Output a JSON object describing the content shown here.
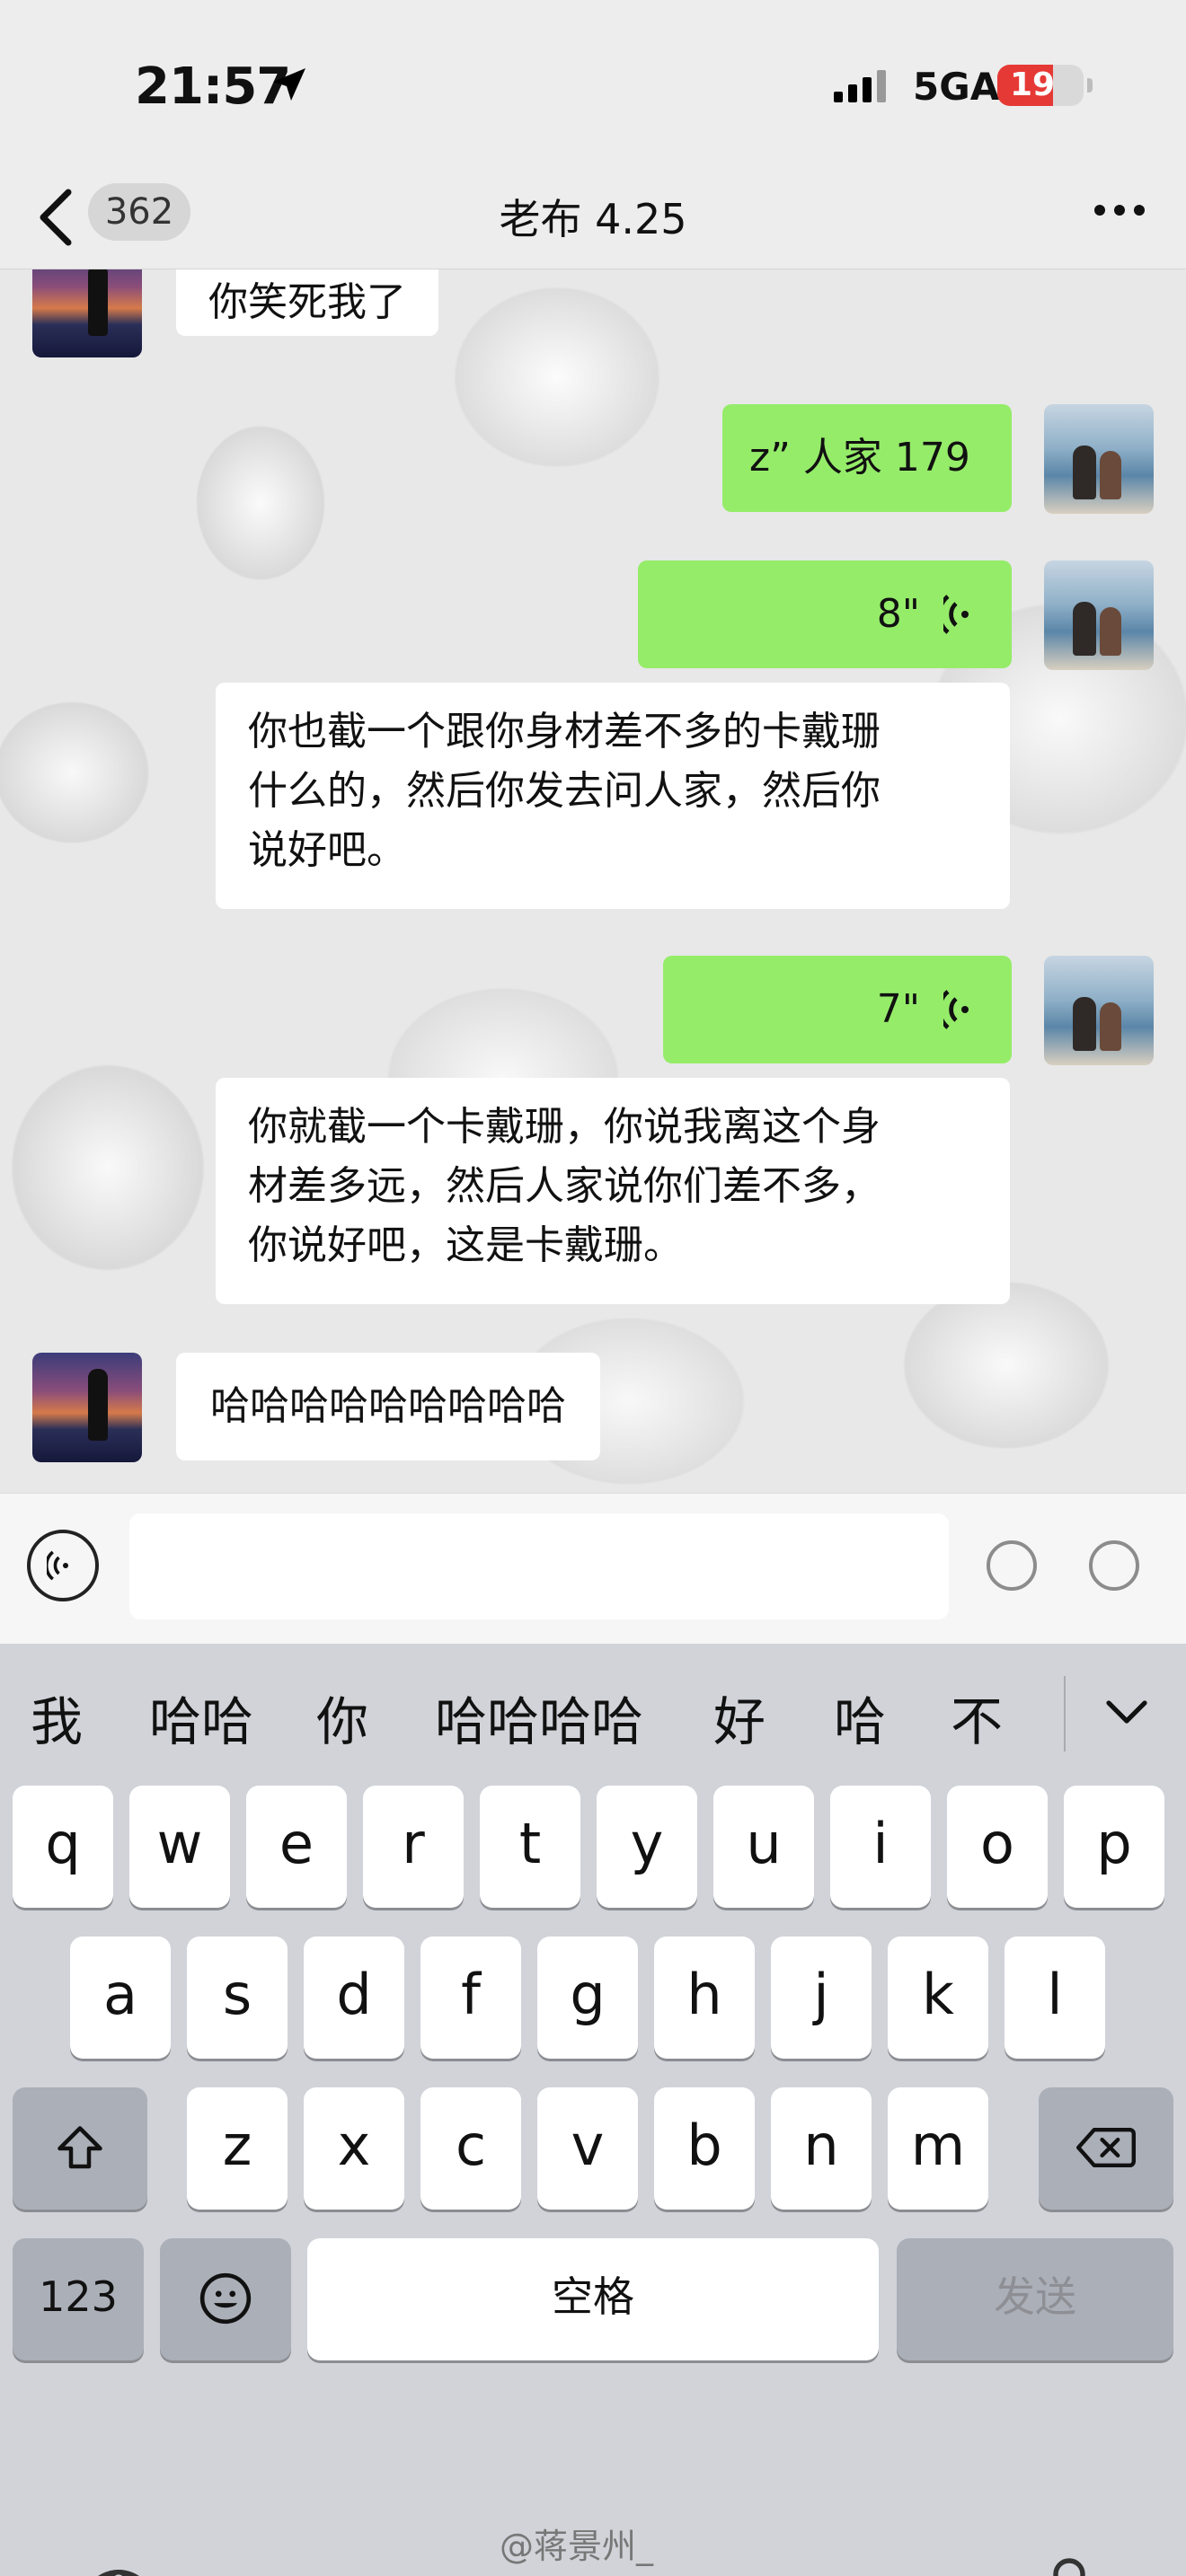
{
  "status_bar": {
    "time": "21:57",
    "network": "5GA",
    "battery": "19"
  },
  "nav": {
    "back_count": "362",
    "title": "老布 4.25"
  },
  "messages": [
    {
      "side": "left",
      "type": "text",
      "text": "你笑死我了"
    },
    {
      "side": "right",
      "type": "text",
      "text": "z” 人家 179"
    },
    {
      "side": "right",
      "type": "voice",
      "duration": "8\""
    },
    {
      "side": "left",
      "type": "text",
      "lines": [
        "你也截一个跟你身材差不多的卡戴珊",
        "什么的，然后你发去问人家，然后你",
        "说好吧。"
      ]
    },
    {
      "side": "right",
      "type": "voice",
      "duration": "7\""
    },
    {
      "side": "left",
      "type": "text",
      "lines": [
        "你就截一个卡戴珊，你说我离这个身",
        "材差多远，然后人家说你们差不多，",
        "你说好吧，这是卡戴珊。"
      ]
    },
    {
      "side": "left",
      "type": "text",
      "text": "哈哈哈哈哈哈哈哈哈"
    }
  ],
  "keyboard": {
    "candidates": [
      "我",
      "哈哈",
      "你",
      "哈哈哈哈",
      "好",
      "哈",
      "不"
    ],
    "row1": [
      "q",
      "w",
      "e",
      "r",
      "t",
      "y",
      "u",
      "i",
      "o",
      "p"
    ],
    "row2": [
      "a",
      "s",
      "d",
      "f",
      "g",
      "h",
      "j",
      "k",
      "l"
    ],
    "row3": [
      "z",
      "x",
      "c",
      "v",
      "b",
      "n",
      "m"
    ],
    "numbers_label": "123",
    "space_label": "空格",
    "send_label": "发送"
  },
  "watermark": "@蒋景州_"
}
